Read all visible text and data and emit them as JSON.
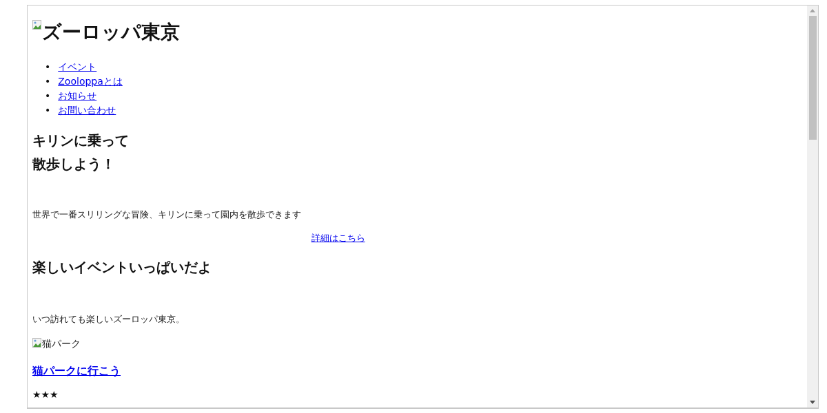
{
  "logo": {
    "alt": "ズーロッパ東京"
  },
  "nav": [
    {
      "marker": "•",
      "label": "イベント"
    },
    {
      "marker": "•",
      "label": "Zooloppaとは"
    },
    {
      "marker": "•",
      "label": "お知らせ"
    },
    {
      "marker": "•",
      "label": "お問い合わせ"
    }
  ],
  "hero": {
    "title_lines": [
      "キリンに乗って",
      "散歩しよう！"
    ],
    "text": "世界で一番スリリングな冒険、キリンに乗って園内を散歩できます",
    "link": "詳細はこちら"
  },
  "events": {
    "title": "楽しいイベントいっぱいだよ",
    "text": "いつ訪れても楽しいズーロッパ東京。",
    "image_alt": "猫パーク",
    "link": "猫パークに行こう",
    "rating": "★★★"
  }
}
